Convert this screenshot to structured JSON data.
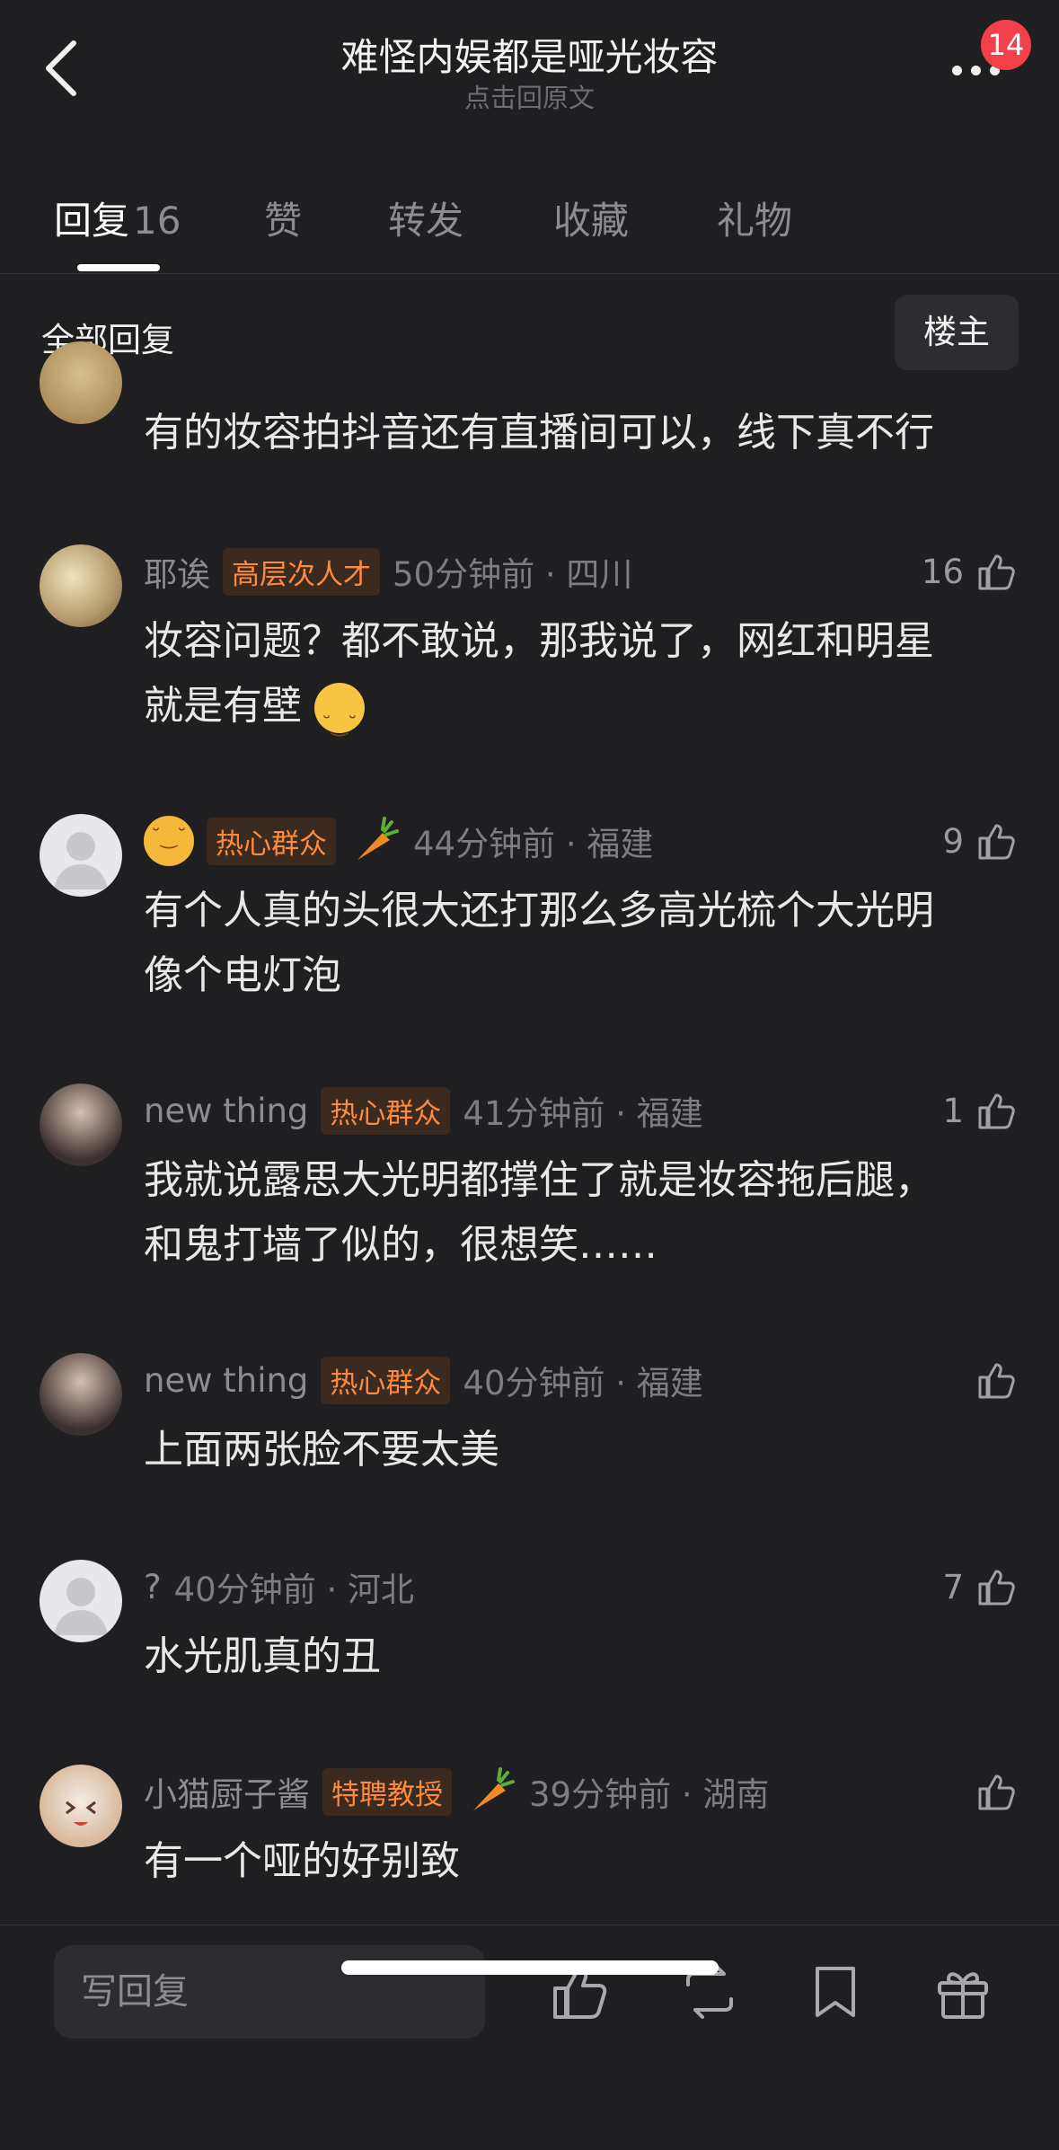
{
  "header": {
    "title": "难怪内娱都是哑光妆容",
    "subtitle": "点击回原文",
    "badge_count": "14"
  },
  "tabs": [
    {
      "label": "回复",
      "count": "16"
    },
    {
      "label": "赞"
    },
    {
      "label": "转发"
    },
    {
      "label": "收藏"
    },
    {
      "label": "礼物"
    }
  ],
  "section": {
    "title": "全部回复",
    "op_button": "楼主"
  },
  "comments": [
    {
      "text": "有的妆容拍抖音还有直播间可以，线下真不行"
    },
    {
      "name": "耶诶",
      "tag": "高层次人才",
      "time": "50分钟前 · 四川",
      "likes": "16",
      "text1": "妆容问题？都不敢说，那我说了，网红和明星",
      "text2": "就是有壁"
    },
    {
      "tag": "热心群众",
      "time": "44分钟前 · 福建",
      "likes": "9",
      "text1": "有个人真的头很大还打那么多高光梳个大光明",
      "text2": "像个电灯泡"
    },
    {
      "name": "new thing",
      "tag": "热心群众",
      "time": "41分钟前 · 福建",
      "likes": "1",
      "text1": "我就说露思大光明都撑住了就是妆容拖后腿，",
      "text2": "和鬼打墙了似的，很想笑……"
    },
    {
      "name": "new thing",
      "tag": "热心群众",
      "time": "40分钟前 · 福建",
      "text1": "上面两张脸不要太美"
    },
    {
      "name": "?",
      "time": "40分钟前 · 河北",
      "likes": "7",
      "text1": "水光肌真的丑"
    },
    {
      "name": "小猫厨子酱",
      "tag": "特聘教授",
      "time": "39分钟前 · 湖南",
      "text1": "有一个哑的好别致"
    }
  ],
  "bottom_bar": {
    "reply_placeholder": "写回复"
  },
  "colors": {
    "background": "#1f1f22",
    "tag_text": "#ff8a3d",
    "badge": "#f2404a"
  }
}
